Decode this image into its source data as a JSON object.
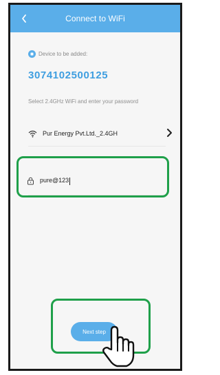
{
  "header": {
    "title": "Connect to WiFi",
    "back_icon": "chevron-left-icon",
    "background_color": "#5aaee9"
  },
  "device": {
    "label": "Device to be added:",
    "id": "3074102500125",
    "icon": "device-dot-icon"
  },
  "wifi_section": {
    "hint": "Select 2.4GHz WiFi and enter your password",
    "network_name": "Pur Energy Pvt.Ltd._2.4GH",
    "wifi_icon": "wifi-icon",
    "chevron_icon": "chevron-right-icon"
  },
  "password": {
    "value": "pure@123",
    "lock_icon": "lock-icon"
  },
  "actions": {
    "next_label": "Next step",
    "button_color": "#5aaee9"
  },
  "annotations": {
    "highlight_color": "#1fa04a",
    "cursor_icon": "hand-pointer-icon"
  }
}
